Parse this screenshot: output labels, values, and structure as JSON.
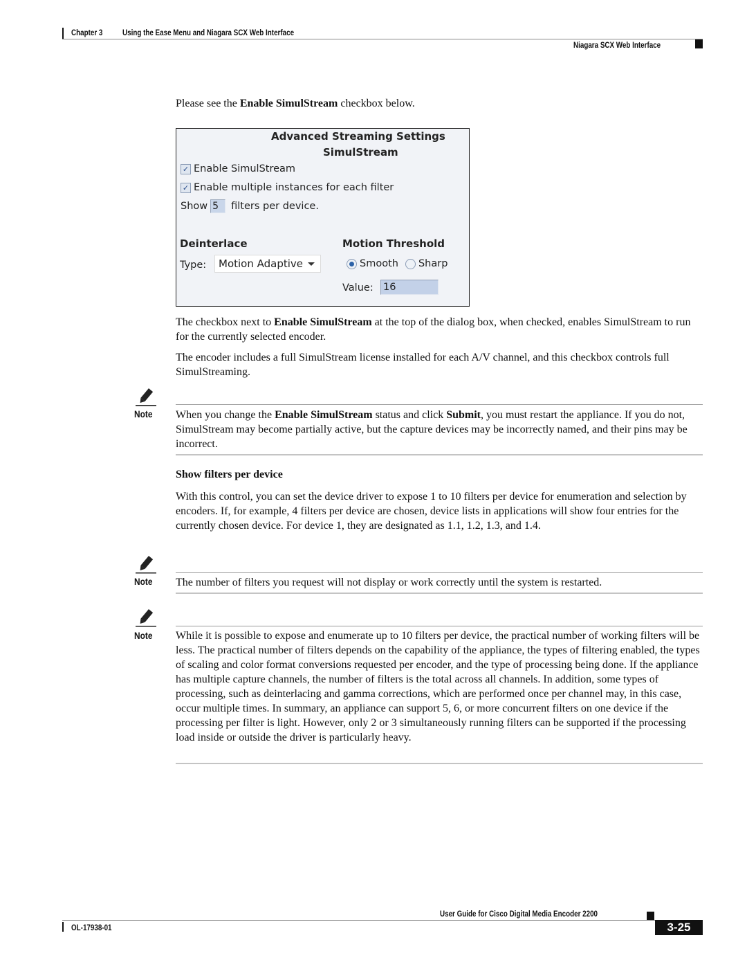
{
  "header": {
    "chapter_label": "Chapter 3",
    "chapter_title": "Using the Ease Menu and Niagara SCX Web Interface",
    "section_title": "Niagara SCX Web Interface"
  },
  "intro": {
    "prefix": "Please see the ",
    "bold": "Enable SimulStream",
    "suffix": " checkbox below."
  },
  "dialog": {
    "title": "Advanced Streaming Settings",
    "subtitle": "SimulStream",
    "checkboxes": [
      {
        "label": "Enable SimulStream",
        "checked": true
      },
      {
        "label": "Enable multiple instances for each filter",
        "checked": true
      }
    ],
    "show_prefix": "Show",
    "show_value": "5",
    "show_suffix": "filters per device.",
    "deinterlace_heading": "Deinterlace",
    "type_label": "Type:",
    "type_value": "Motion Adaptive",
    "motion_heading": "Motion Threshold",
    "radios": [
      {
        "label": "Smooth",
        "selected": true
      },
      {
        "label": "Sharp",
        "selected": false
      }
    ],
    "value_label": "Value:",
    "value": "16"
  },
  "para1": {
    "prefix": "The checkbox next to ",
    "bold": "Enable SimulStream",
    "suffix": " at the top of the dialog box, when checked, enables SimulStream to run for the currently selected encoder."
  },
  "para2": "The encoder includes a full SimulStream license installed for each A/V channel, and this checkbox controls full SimulStreaming.",
  "note_label": "Note",
  "note1": {
    "t1": "When you change the ",
    "b1": "Enable SimulStream",
    "t2": " status and click ",
    "b2": "Submit",
    "t3": ", you must restart the appliance. If you do not, SimulStream may become partially active, but the capture devices may be incorrectly named, and their pins may be incorrect."
  },
  "section_heading": "Show filters per device",
  "para3": "With this control, you can set the device driver to expose 1 to 10 filters per device for enumeration and selection by encoders. If, for example, 4 filters per device are chosen, device lists in applications will show four entries for the currently chosen device. For device 1, they are designated as 1.1, 1.2, 1.3, and 1.4.",
  "note2": "The number of filters you request will not display or work correctly until the system is restarted.",
  "note3": "While it is possible to expose and enumerate up to 10 filters per device, the practical number of working filters will be less. The practical number of filters depends on the capability of the appliance, the types of filtering enabled, the types of scaling and color format conversions requested per encoder, and the type of processing being done. If the appliance has multiple capture channels, the number of filters is the total across all channels. In addition, some types of processing, such as deinterlacing and gamma corrections, which are performed once per channel may, in this case, occur multiple times. In summary, an appliance can support 5, 6, or more concurrent filters on one device if the processing per filter is light. However, only 2 or 3 simultaneously running filters can be supported if the processing load inside or outside the driver is particularly heavy.",
  "footer": {
    "guide_title": "User Guide for Cisco Digital Media Encoder 2200",
    "doc_number": "OL-17938-01",
    "page_number": "3-25"
  }
}
